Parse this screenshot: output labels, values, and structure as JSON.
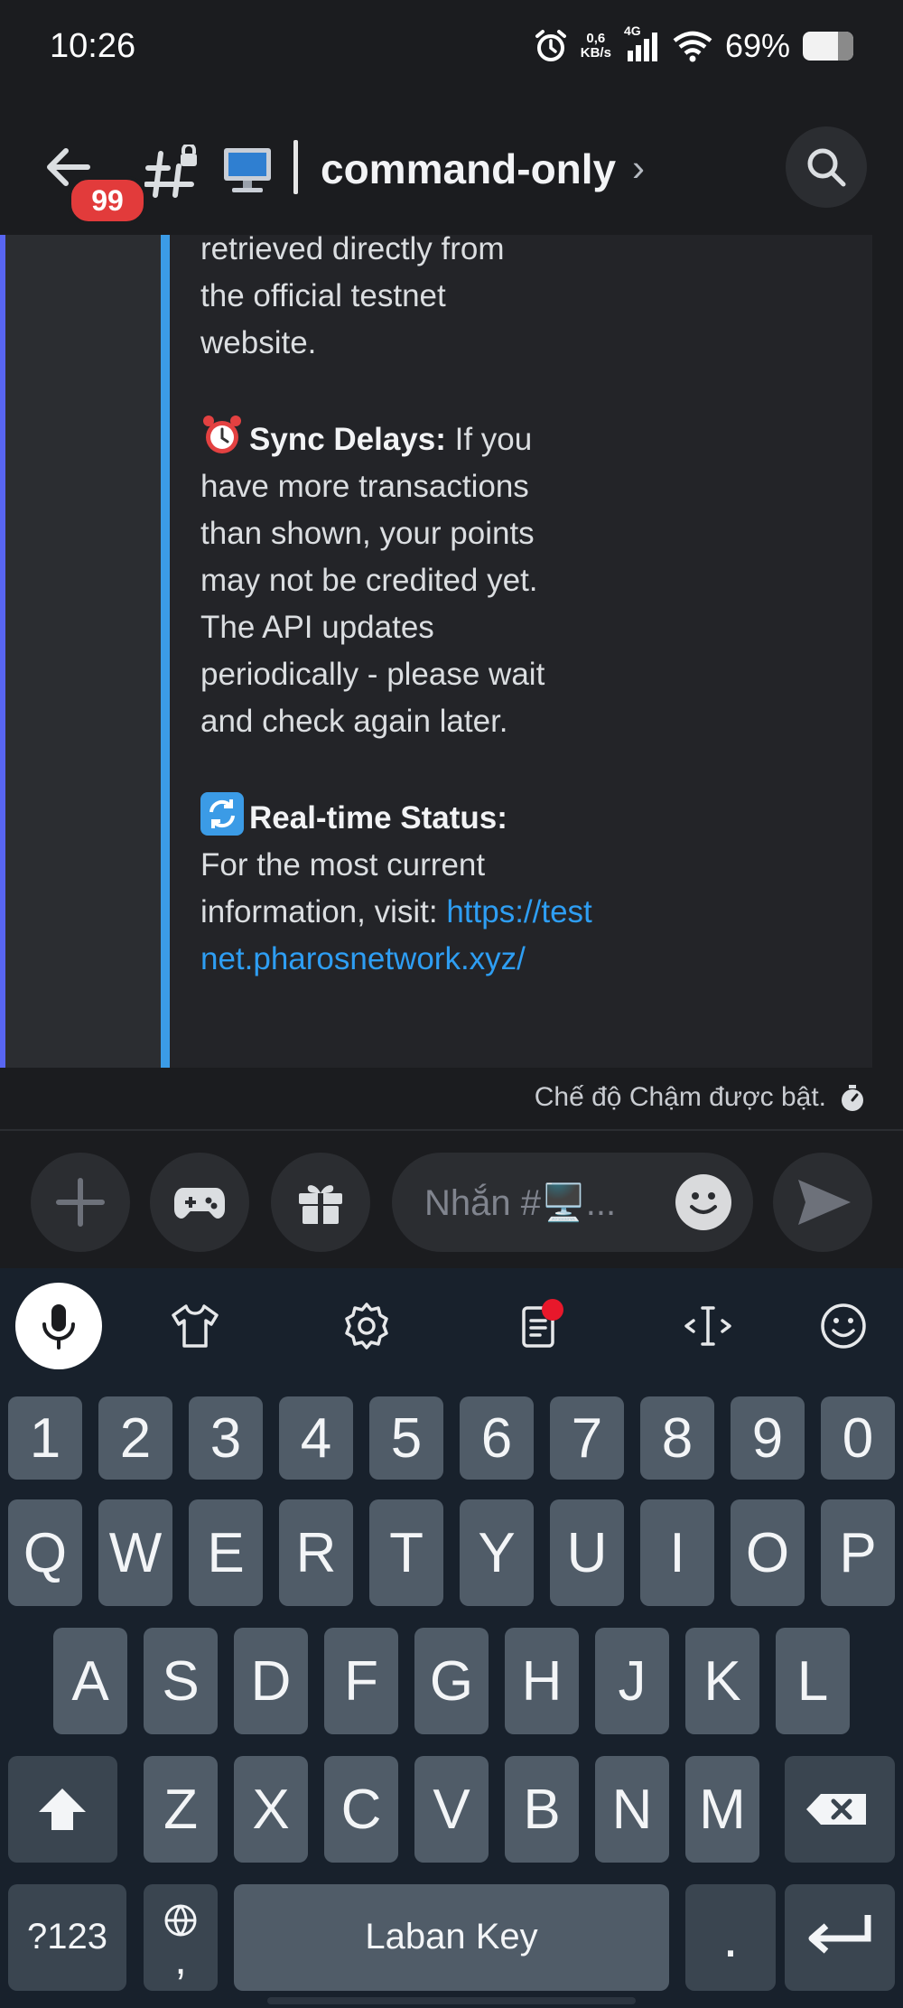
{
  "status_bar": {
    "time": "10:26",
    "net_speed_top": "0,6",
    "net_speed_bottom": "KB/s",
    "signal_label": "4G",
    "battery": "69%"
  },
  "header": {
    "badge_count": "99",
    "channel_name": "command-only",
    "chevron": "›"
  },
  "embed": {
    "intro_line1": "retrieved directly from",
    "intro_line2": "the official testnet",
    "intro_line3": "website.",
    "sync_title": "Sync Delays:",
    "sync_body": " If you have more transactions than shown, your points may not be credited yet. The API updates periodically - please wait and check again later.",
    "status_title": "Real-time Status:",
    "status_body": "For the most current information, visit: ",
    "status_link": "https://testnet.pharosnetwork.xyz/"
  },
  "slowmode": {
    "text": "Chế độ Chậm được bật."
  },
  "composer": {
    "placeholder": "Nhắn #🖥️..."
  },
  "keyboard": {
    "numbers": [
      "1",
      "2",
      "3",
      "4",
      "5",
      "6",
      "7",
      "8",
      "9",
      "0"
    ],
    "row1": [
      "Q",
      "W",
      "E",
      "R",
      "T",
      "Y",
      "U",
      "I",
      "O",
      "P"
    ],
    "row2": [
      "A",
      "S",
      "D",
      "F",
      "G",
      "H",
      "J",
      "K",
      "L"
    ],
    "row3": [
      "Z",
      "X",
      "C",
      "V",
      "B",
      "N",
      "M"
    ],
    "symbols_key": "?123",
    "comma_key": ",",
    "space_label": "Laban Key",
    "period_key": "."
  },
  "colors": {
    "accent_blue": "#5865f2",
    "embed_bar": "#3b9be6",
    "link": "#2e9ef3",
    "badge_red": "#e23b3b"
  }
}
